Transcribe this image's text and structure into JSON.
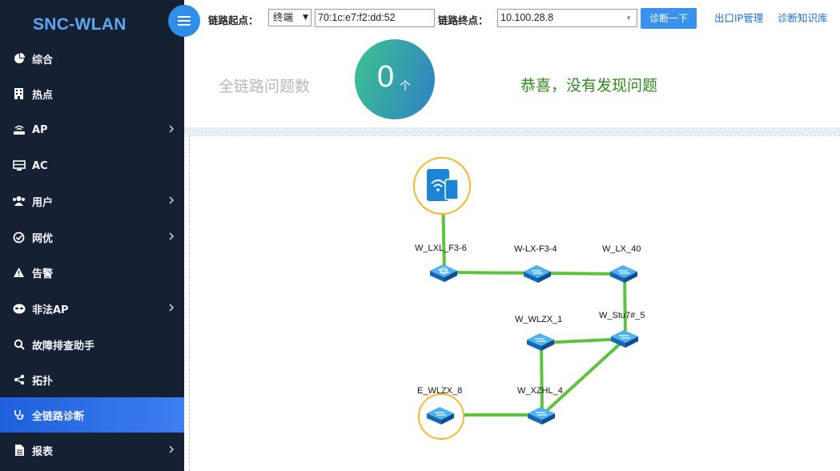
{
  "sidebar": {
    "brand": "SNC-WLAN",
    "items": [
      {
        "label": "综合",
        "icon": "pie-chart-icon",
        "chevron": false,
        "active": false
      },
      {
        "label": "热点",
        "icon": "building-icon",
        "chevron": false,
        "active": false
      },
      {
        "label": "AP",
        "icon": "router-icon",
        "chevron": true,
        "active": false
      },
      {
        "label": "AC",
        "icon": "server-icon",
        "chevron": false,
        "active": false
      },
      {
        "label": "用户",
        "icon": "users-icon",
        "chevron": true,
        "active": false
      },
      {
        "label": "网优",
        "icon": "check-circle-icon",
        "chevron": true,
        "active": false
      },
      {
        "label": "告警",
        "icon": "warning-icon",
        "chevron": false,
        "active": false
      },
      {
        "label": "非法AP",
        "icon": "mask-icon",
        "chevron": true,
        "active": false
      },
      {
        "label": "故障排查助手",
        "icon": "search-icon",
        "chevron": false,
        "active": false
      },
      {
        "label": "拓扑",
        "icon": "share-icon",
        "chevron": false,
        "active": false
      },
      {
        "label": "全链路诊断",
        "icon": "stethoscope-icon",
        "chevron": false,
        "active": true
      },
      {
        "label": "报表",
        "icon": "report-icon",
        "chevron": true,
        "active": false
      }
    ]
  },
  "toolbar": {
    "start_label": "链路起点：",
    "start_type": "终端",
    "start_value": "70:1c:e7:f2:dd:52",
    "end_label": "链路终点：",
    "end_value": "10.100.28.8",
    "diagnose_button": "诊断一下",
    "link_exit_ip": "出口IP管理",
    "link_knowledge": "诊断知识库"
  },
  "summary": {
    "title": "全链路问题数",
    "count": "0",
    "unit": "个",
    "message": "恭喜，没有发现问题"
  },
  "topology": {
    "nodes": [
      {
        "id": "client",
        "label": "",
        "icon": "wifi-device-icon"
      },
      {
        "id": "n1",
        "label": "W_LXL_F3-6",
        "icon": "ap-switch-icon"
      },
      {
        "id": "n2",
        "label": "W-LX-F3-4",
        "icon": "switch-icon"
      },
      {
        "id": "n3",
        "label": "W_LX_40",
        "icon": "switch-icon"
      },
      {
        "id": "n4",
        "label": "W_WLZX_1",
        "icon": "switch-icon"
      },
      {
        "id": "n5",
        "label": "W_Stu7#_5",
        "icon": "switch-icon"
      },
      {
        "id": "n6",
        "label": "E_WLZX_8",
        "icon": "switch-icon"
      },
      {
        "id": "n7",
        "label": "W_XZHL_4",
        "icon": "switch-icon"
      }
    ],
    "colors": {
      "link": "#5cc43c",
      "highlight": "#f5b82a",
      "device": "#1c84d6"
    }
  }
}
